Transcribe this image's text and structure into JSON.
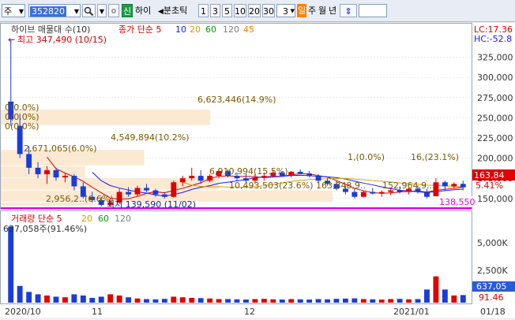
{
  "toolbar": {
    "mode": "주",
    "code": "352820",
    "signal_label": "신",
    "name": "하이",
    "chart_type": "분초틱",
    "intervals": [
      "1",
      "3",
      "5",
      "10",
      "20",
      "30"
    ],
    "period_value": "3",
    "period_units": [
      "일",
      "주",
      "월",
      "년"
    ],
    "active_unit": "일"
  },
  "price_panel": {
    "title": "하이브 매물대 수(10)",
    "ma_label": "종가 단순 5",
    "ma_periods": [
      "10",
      "20",
      "60",
      "120",
      "45"
    ],
    "ma_colors": [
      "#1a1aff",
      "#d4a000",
      "#0a9a0a",
      "#7f7f7f",
      "#ff7f00"
    ],
    "lc": "LC:17.36",
    "hc": "HC:-52.8",
    "y_ticks": [
      "325,000",
      "300,000",
      "275,000",
      "250,000",
      "225,000",
      "200,000",
      "175,000",
      "150,000"
    ],
    "max_label": "최고 347,490 (10/15)",
    "min_label": "최저 139,590 (11/02)",
    "current_price": "163,84",
    "current_pct": "5.41%",
    "magenta_level": "138,550",
    "volume_profile": [
      {
        "label": "0(0.0%)",
        "value": 0,
        "pct": 0.0
      },
      {
        "label": "0(0.0%)",
        "value": 0,
        "pct": 0.0
      },
      {
        "label": "0(0.0%)",
        "value": 0,
        "pct": 0.0
      },
      {
        "label": "6,623,446(14.9%)",
        "value": 6623446,
        "pct": 14.9
      },
      {
        "label": "4,549,894(10.2%)",
        "value": 4549894,
        "pct": 10.2
      },
      {
        "label": "2,671,065(6.0%)",
        "value": 2671065,
        "pct": 6.0
      },
      {
        "label": "6,910,994(15.5%)",
        "value": 6910994,
        "pct": 15.5
      },
      {
        "label": "10,493,503(23.6%)",
        "value": 10493503,
        "pct": 23.6
      },
      {
        "label": "2,956,2..(6.6%)",
        "value": 2956200,
        "pct": 6.6
      }
    ],
    "overlap_labels": [
      "1,(0.0%)",
      "16,(23.1%)",
      "163,848,9..",
      "152,964,9..."
    ]
  },
  "volume_panel": {
    "title": "거래량 단순 5",
    "ma_periods": [
      "20",
      "60",
      "120"
    ],
    "max_label": "637,058주(91.46%)",
    "y_ticks": [
      "5,000K",
      "2,500K"
    ],
    "current_volume": "637,05",
    "current_pct": "91.46"
  },
  "x_axis": {
    "labels": [
      "2020/10",
      "11",
      "12",
      "2021/01",
      "01/18"
    ]
  },
  "chart_data": {
    "type": "candlestick",
    "ylim": [
      140000,
      350000
    ],
    "candles": [
      [
        270000,
        347490,
        240000,
        248000
      ],
      [
        240000,
        255000,
        200000,
        205000
      ],
      [
        205000,
        215000,
        180000,
        188000
      ],
      [
        188000,
        195000,
        175000,
        180000
      ],
      [
        180000,
        190000,
        168000,
        185000
      ],
      [
        185000,
        188000,
        172000,
        176000
      ],
      [
        176000,
        182000,
        170000,
        178000
      ],
      [
        178000,
        180000,
        160000,
        165000
      ],
      [
        165000,
        170000,
        150000,
        152000
      ],
      [
        152000,
        158000,
        145000,
        148000
      ],
      [
        148000,
        152000,
        140000,
        142000
      ],
      [
        142000,
        150000,
        139590,
        145000
      ],
      [
        145000,
        162000,
        144000,
        158000
      ],
      [
        158000,
        164000,
        152000,
        155000
      ],
      [
        155000,
        166000,
        153000,
        163000
      ],
      [
        163000,
        168000,
        158000,
        160000
      ],
      [
        160000,
        162000,
        152000,
        155000
      ],
      [
        155000,
        158000,
        150000,
        152000
      ],
      [
        152000,
        172000,
        151000,
        170000
      ],
      [
        170000,
        178000,
        165000,
        175000
      ],
      [
        175000,
        188000,
        172000,
        178000
      ],
      [
        178000,
        185000,
        168000,
        172000
      ],
      [
        172000,
        180000,
        170000,
        178000
      ],
      [
        178000,
        186000,
        175000,
        184000
      ],
      [
        184000,
        186000,
        176000,
        178000
      ],
      [
        178000,
        182000,
        172000,
        175000
      ],
      [
        175000,
        180000,
        170000,
        172000
      ],
      [
        172000,
        180000,
        168000,
        176000
      ],
      [
        176000,
        182000,
        172000,
        178000
      ],
      [
        178000,
        185000,
        176000,
        182000
      ],
      [
        182000,
        184000,
        177000,
        178000
      ],
      [
        178000,
        184000,
        176000,
        183000
      ],
      [
        183000,
        186000,
        180000,
        181000
      ],
      [
        181000,
        184000,
        176000,
        178000
      ],
      [
        178000,
        180000,
        170000,
        172000
      ],
      [
        172000,
        175000,
        166000,
        168000
      ],
      [
        168000,
        172000,
        160000,
        162000
      ],
      [
        162000,
        166000,
        155000,
        158000
      ],
      [
        158000,
        162000,
        150000,
        152000
      ],
      [
        152000,
        160000,
        151000,
        158000
      ],
      [
        158000,
        163000,
        155000,
        156000
      ],
      [
        156000,
        160000,
        152000,
        158000
      ],
      [
        158000,
        162000,
        154000,
        160000
      ],
      [
        160000,
        165000,
        156000,
        158000
      ],
      [
        158000,
        164000,
        155000,
        162000
      ],
      [
        162000,
        166000,
        156000,
        158000
      ],
      [
        158000,
        162000,
        150000,
        152000
      ],
      [
        152000,
        175000,
        150000,
        170000
      ],
      [
        170000,
        172000,
        160000,
        165000
      ],
      [
        165000,
        170000,
        162000,
        168000
      ],
      [
        168000,
        172000,
        160000,
        163840
      ]
    ],
    "volumes": [
      6370,
      1400,
      900,
      700,
      600,
      500,
      450,
      700,
      600,
      400,
      500,
      700,
      600,
      450,
      350,
      300,
      280,
      320,
      500,
      450,
      400,
      380,
      350,
      300,
      300,
      280,
      260,
      300,
      320,
      280,
      260,
      300,
      280,
      260,
      300,
      280,
      320,
      340,
      360,
      300,
      280,
      260,
      300,
      320,
      280,
      300,
      1100,
      2200,
      1100,
      600,
      637
    ]
  }
}
